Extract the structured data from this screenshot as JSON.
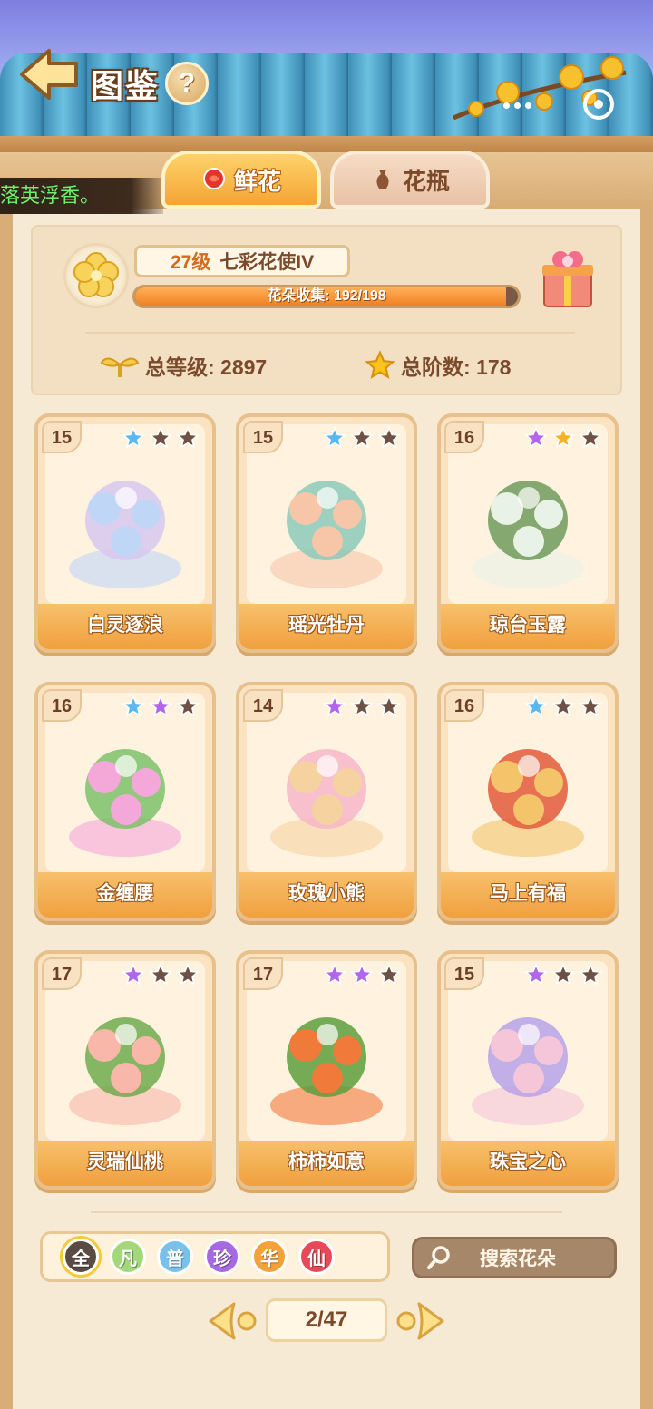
{
  "header": {
    "title": "图鉴",
    "help_label": "?"
  },
  "ticker": {
    "text": "落英浮香。"
  },
  "tabs": [
    {
      "label": "鲜花",
      "selected": true
    },
    {
      "label": "花瓶",
      "selected": false
    }
  ],
  "summary": {
    "level": "27级",
    "rank_title": "七彩花使IV",
    "progress_label": "花朵收集: 192/198",
    "collected": 192,
    "total": 198,
    "total_level_label": "总等级: 2897",
    "total_stars_label": "总阶数: 178"
  },
  "cards": [
    {
      "level": "15",
      "name": "白灵逐浪",
      "stars": [
        "blue",
        "dark",
        "dark"
      ]
    },
    {
      "level": "15",
      "name": "瑶光牡丹",
      "stars": [
        "blue",
        "dark",
        "dark"
      ]
    },
    {
      "level": "16",
      "name": "琼台玉露",
      "stars": [
        "purple",
        "gold",
        "dark"
      ]
    },
    {
      "level": "16",
      "name": "金缠腰",
      "stars": [
        "blue",
        "purple",
        "dark"
      ]
    },
    {
      "level": "14",
      "name": "玫瑰小熊",
      "stars": [
        "purple",
        "dark",
        "dark"
      ]
    },
    {
      "level": "16",
      "name": "马上有福",
      "stars": [
        "blue",
        "dark",
        "dark"
      ]
    },
    {
      "level": "17",
      "name": "灵瑞仙桃",
      "stars": [
        "purple",
        "dark",
        "dark"
      ]
    },
    {
      "level": "17",
      "name": "柿柿如意",
      "stars": [
        "purple",
        "purple",
        "dark"
      ]
    },
    {
      "level": "15",
      "name": "珠宝之心",
      "stars": [
        "purple",
        "dark",
        "dark"
      ]
    }
  ],
  "filters": [
    "全",
    "凡",
    "普",
    "珍",
    "华",
    "仙"
  ],
  "search": {
    "placeholder": "搜索花朵"
  },
  "pagination": {
    "label": "2/47"
  },
  "colors": {
    "star_blue": "#5bb7f0",
    "star_purple": "#b167ec",
    "star_gold": "#f7b322",
    "star_dark": "#6d5145"
  }
}
